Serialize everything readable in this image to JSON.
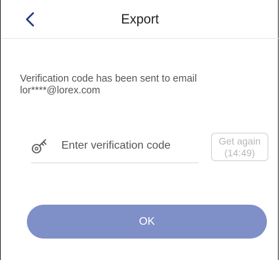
{
  "header": {
    "title": "Export",
    "back_icon": "chevron-left-icon"
  },
  "message": {
    "line1": "Verification code has been sent to email",
    "line2": "lor****@lorex.com"
  },
  "verification": {
    "icon": "key-icon",
    "placeholder": "Enter verification code",
    "value": ""
  },
  "get_again": {
    "label": "Get again",
    "timer": "(14:49)"
  },
  "ok_button": {
    "label": "OK"
  },
  "colors": {
    "accent": "#1e3a8a",
    "button": "#7f8fc8",
    "disabled_text": "#b8b8b8"
  }
}
